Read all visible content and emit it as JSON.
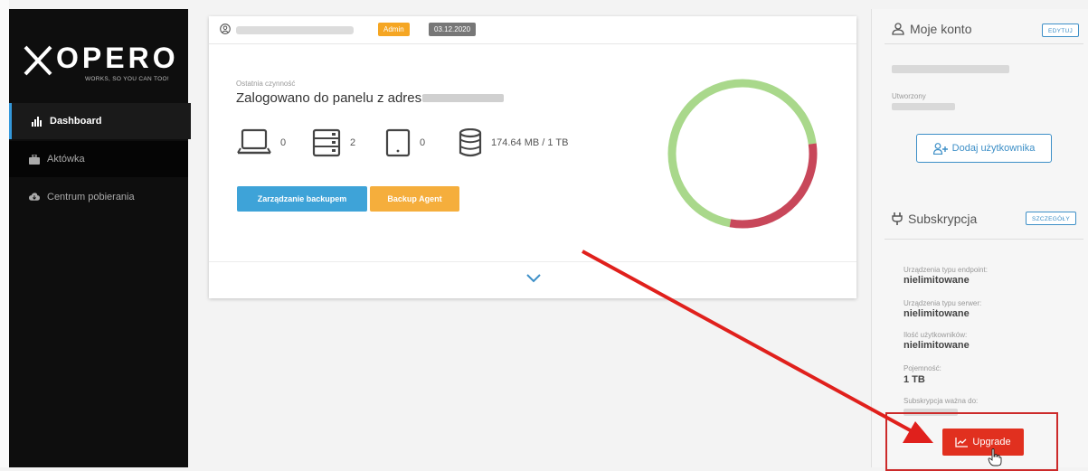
{
  "brand": {
    "name": "OPERO",
    "tagline": "WORKS, SO YOU CAN TOO!"
  },
  "sidebar": {
    "items": [
      {
        "label": "Dashboard",
        "icon": "chart-bars-icon"
      },
      {
        "label": "Aktówka",
        "icon": "briefcase-icon"
      },
      {
        "label": "Centrum pobierania",
        "icon": "cloud-download-icon"
      }
    ]
  },
  "card": {
    "badge_admin": "Admin",
    "badge_date": "03.12.2020",
    "last_activity_label": "Ostatnia czynność",
    "last_activity_text": "Zalogowano do panelu z adresu",
    "stats": [
      {
        "icon": "laptop-icon",
        "value": "0"
      },
      {
        "icon": "server-icon",
        "value": "2"
      },
      {
        "icon": "tablet-icon",
        "value": "0"
      },
      {
        "icon": "database-icon",
        "value": "174.64 MB / 1 TB"
      }
    ],
    "btn_backup": "Zarządzanie backupem",
    "btn_agent": "Backup Agent",
    "donut": {
      "green_fraction": 0.7,
      "red_fraction": 0.3,
      "green_color": "#a9d88b",
      "red_color": "#c8475a"
    }
  },
  "account": {
    "title": "Moje konto",
    "edit_label": "EDYTUJ",
    "created_label": "Utworzony",
    "add_user_label": "Dodaj użytkownika"
  },
  "subscription": {
    "title": "Subskrypcja",
    "details_label": "SZCZEGÓŁY",
    "rows": [
      {
        "label": "Urządzenia typu endpoint:",
        "value": "nielimitowane"
      },
      {
        "label": "Urządzenia typu serwer:",
        "value": "nielimitowane"
      },
      {
        "label": "Ilość użytkowników:",
        "value": "nielimitowane"
      },
      {
        "label": "Pojemność:",
        "value": "1 TB"
      }
    ],
    "valid_label": "Subskrypcja ważna do:"
  },
  "upgrade": {
    "label": "Upgrade"
  },
  "colors": {
    "accent_blue": "#3ea3d8",
    "accent_orange": "#f5ae3c",
    "upgrade_red": "#e1301f",
    "annotation_red": "#e0201c"
  }
}
